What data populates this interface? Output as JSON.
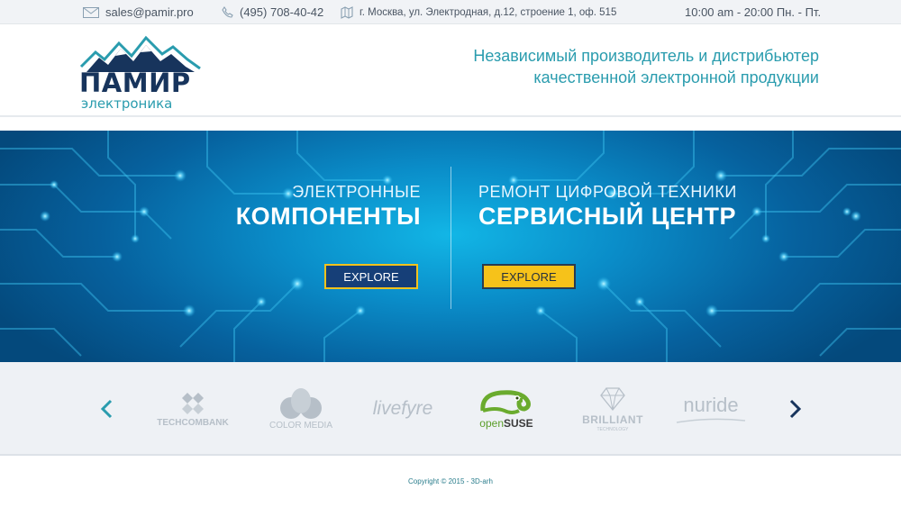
{
  "topbar": {
    "email": "sales@pamir.pro",
    "phone": "(495) 708-40-42",
    "address": "г. Москва, ул. Электродная, д.12, строение 1, оф. 515",
    "hours": "10:00 am - 20:00 Пн. - Пт."
  },
  "header": {
    "logo_title": "ПАМИР",
    "logo_subtitle": "электроника",
    "tagline_line1": "Независимый производитель и дистрибьютер",
    "tagline_line2": "качественной электронной продукции"
  },
  "hero": {
    "left": {
      "small": "ЭЛЕКТРОННЫЕ",
      "big": "КОМПОНЕНТЫ",
      "button": "EXPLORE"
    },
    "right": {
      "small": "РЕМОНТ ЦИФРОВОЙ ТЕХНИКИ",
      "big": "СЕРВИСНЫЙ ЦЕНТР",
      "button": "EXPLORE"
    }
  },
  "partners": {
    "items": [
      {
        "name": "TECHCOMBANK",
        "icon": "techcombank-logo"
      },
      {
        "name": "COLOR MEDIA",
        "icon": "color-media-logo"
      },
      {
        "name": "livefyre",
        "icon": "livefyre-logo"
      },
      {
        "name_part1": "open",
        "name_part2": "SUSE",
        "icon": "opensuse-logo"
      },
      {
        "name": "BRILLIANT",
        "sub": "TECHNOLOGY",
        "icon": "brilliant-logo"
      },
      {
        "name": "nuride",
        "icon": "nuride-logo"
      }
    ],
    "prev_icon": "chevron-left-icon",
    "next_icon": "chevron-right-icon"
  },
  "footer": {
    "copyright": "Copyright © 2015 - 3D-arh"
  },
  "colors": {
    "brand_dark": "#17345c",
    "brand_teal": "#2a9cae",
    "button_dark": "#163f78",
    "button_yellow": "#f6c21a"
  }
}
